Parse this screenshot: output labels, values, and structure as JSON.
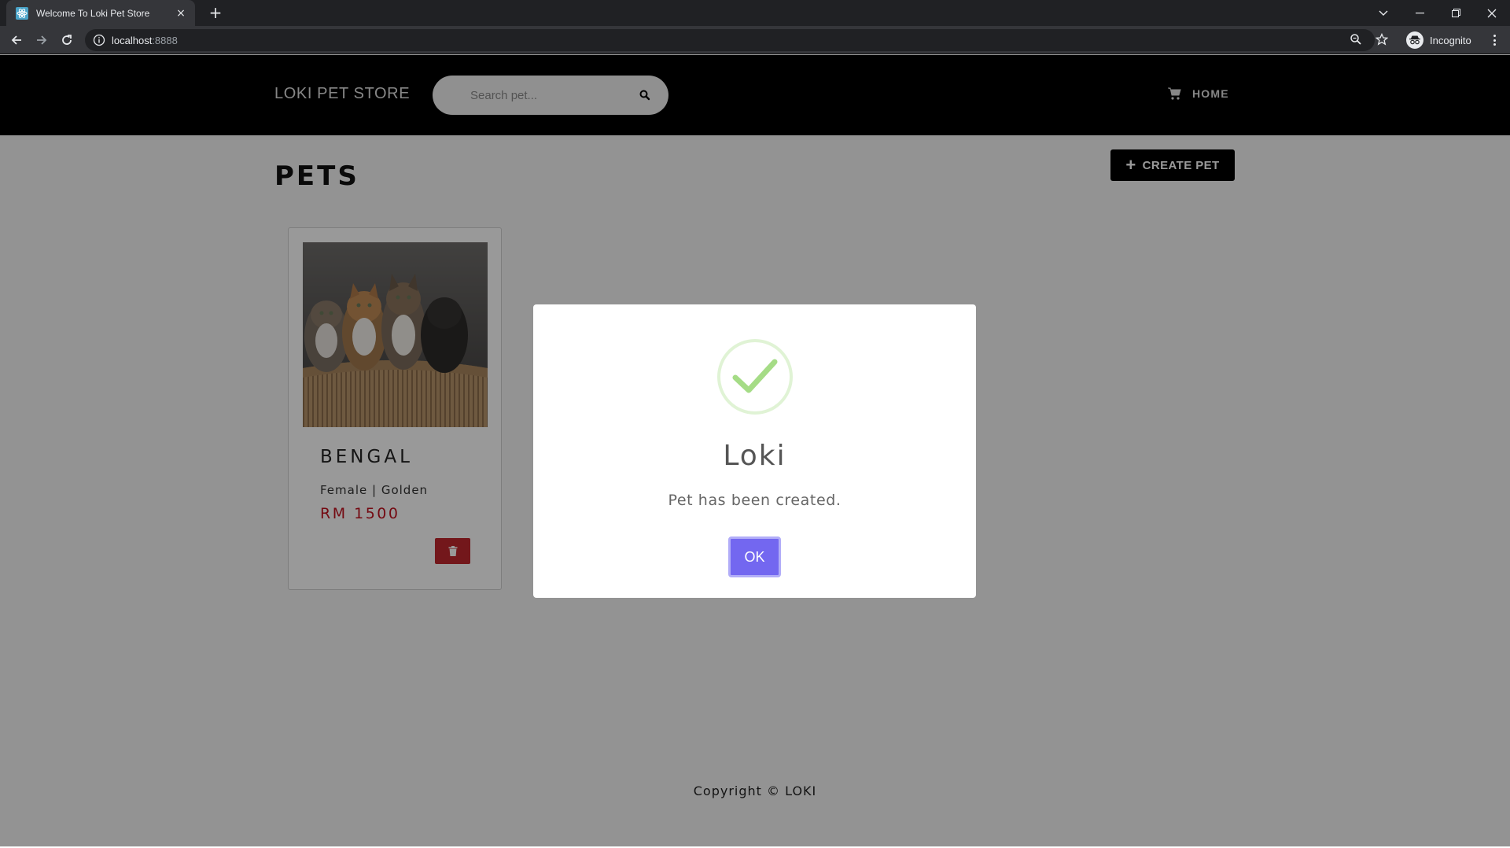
{
  "browser": {
    "tab_title": "Welcome To Loki Pet Store",
    "tab_close": "×",
    "new_tab": "+",
    "url_host": "localhost",
    "url_port": ":8888",
    "profile_label": "Incognito"
  },
  "nav": {
    "brand": "LOKI PET STORE",
    "search_placeholder": "Search pet...",
    "home_label": "HOME"
  },
  "main": {
    "title": "PETS",
    "create_button_icon": "+",
    "create_button_label": "CREATE PET"
  },
  "pets": [
    {
      "name": "BENGAL",
      "details": "Female | Golden",
      "price": "RM 1500",
      "image": "kittens-in-basket"
    }
  ],
  "footer": {
    "copyright": "Copyright © LOKI"
  },
  "modal": {
    "icon": "success-check-icon",
    "title": "Loki",
    "message": "Pet has been created.",
    "ok_label": "OK"
  },
  "colors": {
    "accent": "#7367f0",
    "delete": "#c0272d",
    "price": "#c1121f",
    "success": "#a5dc86"
  }
}
